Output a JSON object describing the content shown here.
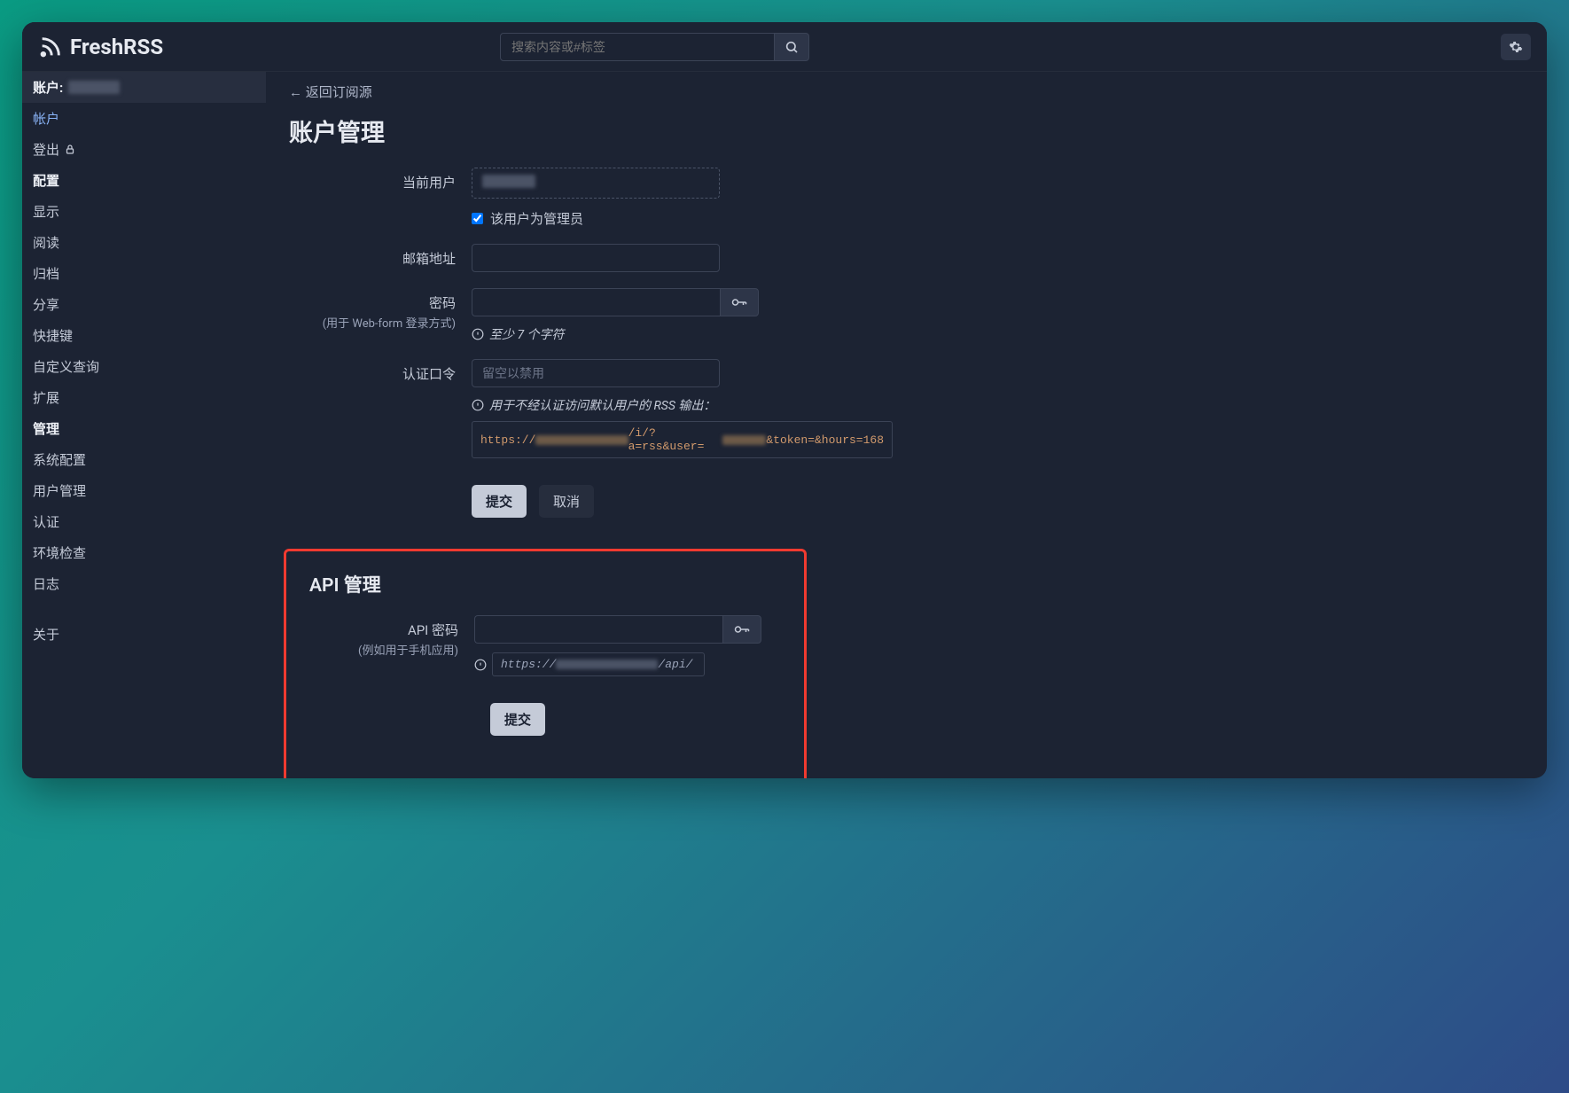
{
  "app": {
    "name": "FreshRSS"
  },
  "search": {
    "placeholder": "搜索内容或#标签"
  },
  "sidebar": {
    "account_label": "账户:",
    "items": [
      {
        "label": "帐户",
        "type": "active"
      },
      {
        "label": "登出",
        "type": "link",
        "icon": "lock"
      },
      {
        "label": "配置",
        "type": "header"
      },
      {
        "label": "显示",
        "type": "link"
      },
      {
        "label": "阅读",
        "type": "link"
      },
      {
        "label": "归档",
        "type": "link"
      },
      {
        "label": "分享",
        "type": "link"
      },
      {
        "label": "快捷键",
        "type": "link"
      },
      {
        "label": "自定义查询",
        "type": "link"
      },
      {
        "label": "扩展",
        "type": "link"
      },
      {
        "label": "管理",
        "type": "header"
      },
      {
        "label": "系统配置",
        "type": "link"
      },
      {
        "label": "用户管理",
        "type": "link"
      },
      {
        "label": "认证",
        "type": "link"
      },
      {
        "label": "环境检查",
        "type": "link"
      },
      {
        "label": "日志",
        "type": "link"
      }
    ],
    "about": "关于"
  },
  "main": {
    "back": "← 返回订阅源",
    "title": "账户管理",
    "current_user_label": "当前用户",
    "admin_checkbox": "该用户为管理员",
    "email_label": "邮箱地址",
    "password_label": "密码",
    "password_sub": "(用于 Web-form 登录方式)",
    "password_hint": "至少 7 个字符",
    "token_label": "认证口令",
    "token_placeholder": "留空以禁用",
    "token_hint": "用于不经认证访问默认用户的 RSS 输出：",
    "token_url_prefix": "https://",
    "token_url_suffix": "/i/?a=rss&user=",
    "token_url_tail": "&token=&hours=168",
    "submit": "提交",
    "cancel": "取消"
  },
  "api": {
    "title": "API 管理",
    "password_label": "API 密码",
    "password_sub": "(例如用于手机应用)",
    "url_prefix": "https://",
    "url_suffix": "/api/",
    "submit": "提交"
  }
}
